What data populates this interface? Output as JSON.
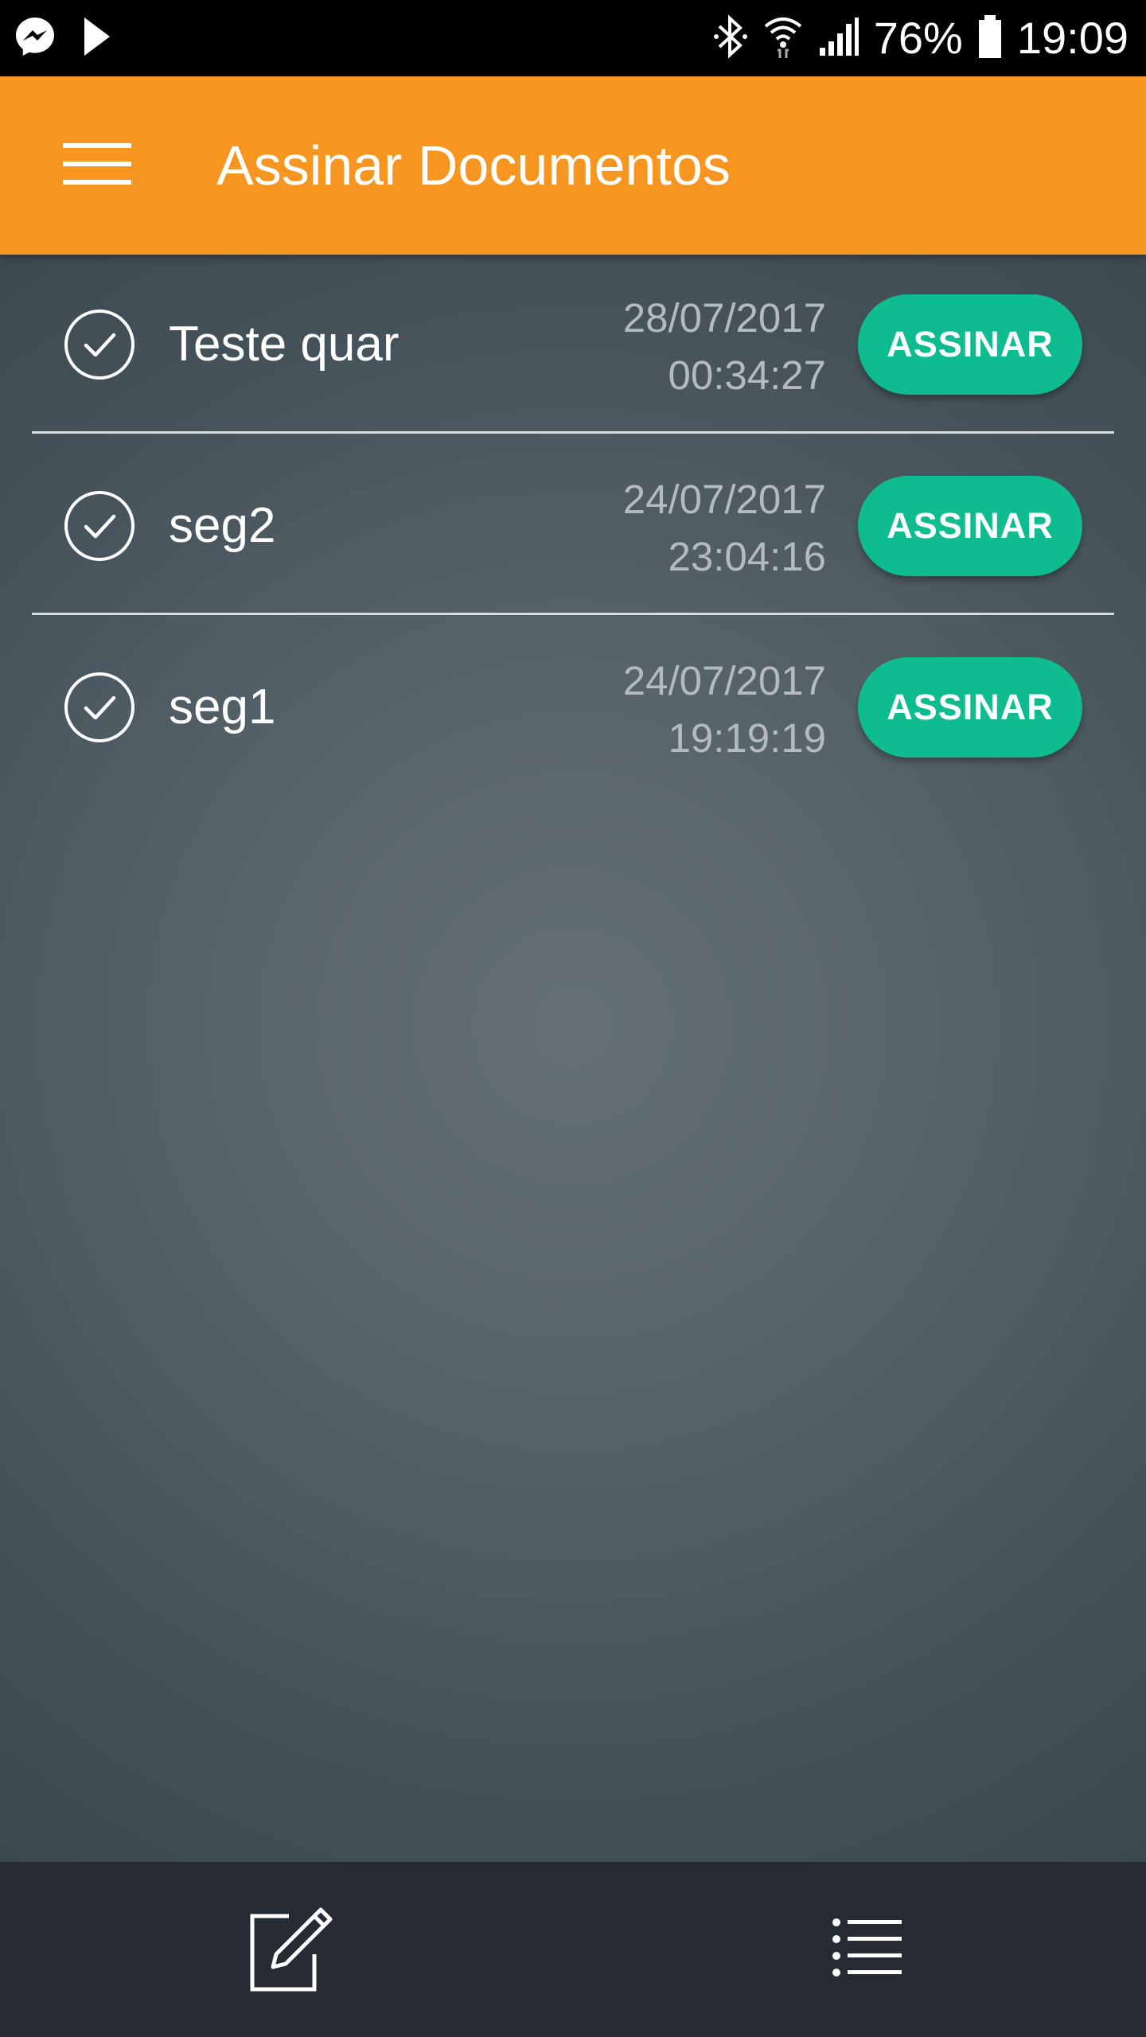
{
  "status_bar": {
    "left_icons": [
      "messenger-icon",
      "play-store-icon"
    ],
    "right_icons": [
      "bluetooth-icon",
      "wifi-icon",
      "signal-icon",
      "battery-icon"
    ],
    "battery": "76%",
    "time": "19:09"
  },
  "app_bar": {
    "menu_icon": "hamburger-menu-icon",
    "title": "Assinar Documentos"
  },
  "documents": [
    {
      "name": "Teste quar",
      "date": "28/07/2017",
      "time": "00:34:27",
      "action": "ASSINAR"
    },
    {
      "name": "seg2",
      "date": "24/07/2017",
      "time": "23:04:16",
      "action": "ASSINAR"
    },
    {
      "name": "seg1",
      "date": "24/07/2017",
      "time": "19:19:19",
      "action": "ASSINAR"
    }
  ],
  "bottom_bar": {
    "left_icon": "edit-document-icon",
    "right_icon": "list-icon"
  },
  "colors": {
    "app_bar": "#f69520",
    "button": "#0fbc8f",
    "bottom_bar": "#252a33"
  }
}
